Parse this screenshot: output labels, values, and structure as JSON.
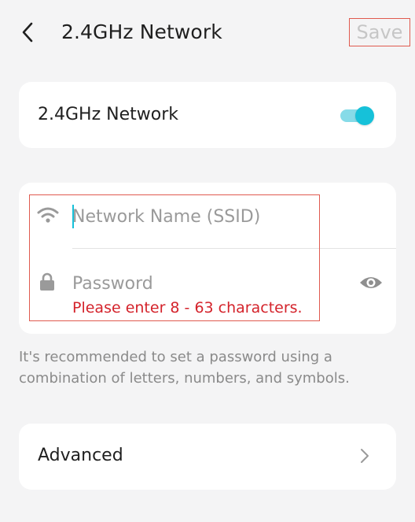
{
  "header": {
    "title": "2.4GHz Network",
    "save_label": "Save"
  },
  "network_toggle": {
    "label": "2.4GHz Network",
    "enabled": true,
    "accent": "#16c1d9"
  },
  "credentials": {
    "ssid_placeholder": "Network Name (SSID)",
    "ssid_value": "",
    "password_placeholder": "Password",
    "password_value": "",
    "password_error": "Please enter 8 - 63 characters.",
    "error_color": "#d4232b"
  },
  "hint": "It's recommended to set a password using a combination of letters, numbers, and symbols.",
  "advanced": {
    "label": "Advanced"
  },
  "icons": [
    "back-icon",
    "wifi-icon",
    "lock-icon",
    "eye-icon",
    "chevron-right-icon"
  ]
}
